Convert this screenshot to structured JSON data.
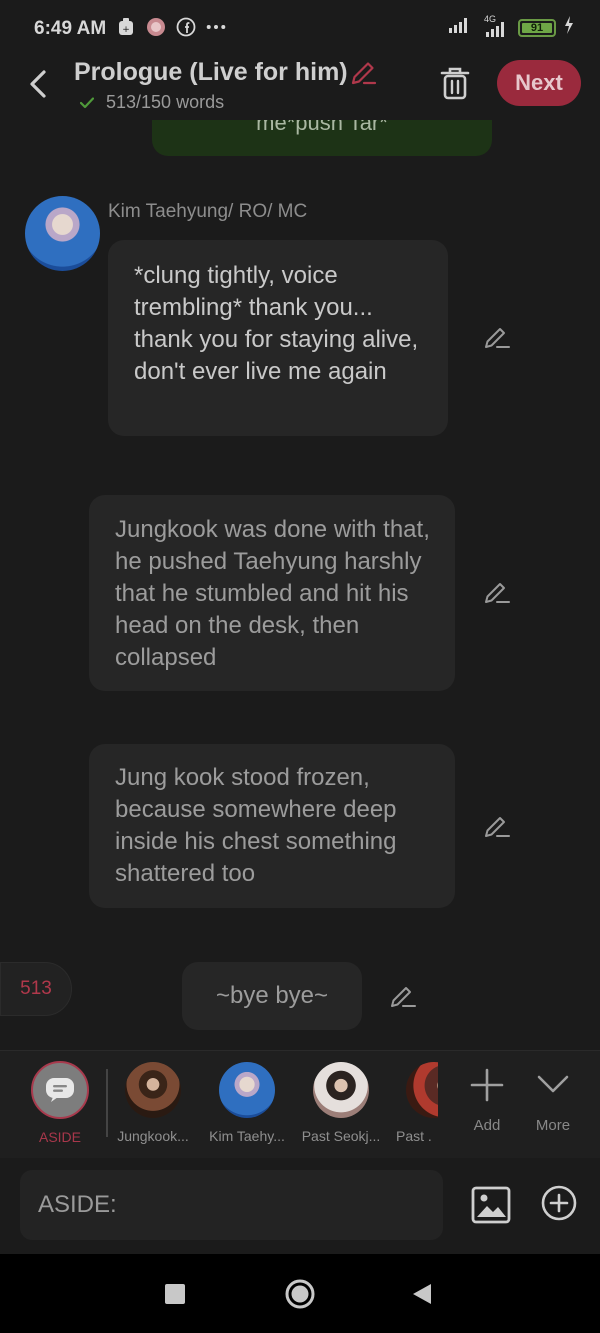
{
  "status_bar": {
    "time": "6:49 AM",
    "battery": "91",
    "network": "4G"
  },
  "header": {
    "title": "Prologue (Live for him)",
    "word_count": "513/150 words",
    "next_label": "Next"
  },
  "chat": {
    "partial_top_text": "me*push Tar*",
    "messages": [
      {
        "character": "Kim Taehyung/ RO/ MC",
        "text": "*clung tightly, voice trembling* thank you... thank you for staying alive, don't ever live me again"
      },
      {
        "character": "",
        "text": "Jungkook was done with that, he pushed Taehyung harshly that he stumbled and hit his head on the desk, then collapsed"
      },
      {
        "character": "",
        "text": "Jung kook stood frozen, because somewhere deep inside his chest something shattered too"
      },
      {
        "character": "",
        "text": "~bye bye~"
      }
    ],
    "word_badge": "513"
  },
  "characters": [
    {
      "label": "ASIDE"
    },
    {
      "label": "Jungkook..."
    },
    {
      "label": "Kim Taehy..."
    },
    {
      "label": "Past Seokj..."
    },
    {
      "label": "Past ."
    }
  ],
  "tools": {
    "add_label": "Add",
    "more_label": "More"
  },
  "input": {
    "value": "ASIDE:"
  },
  "colors": {
    "accent": "#9a2a3d",
    "background": "#1b1b1b",
    "bubble": "#262626"
  }
}
